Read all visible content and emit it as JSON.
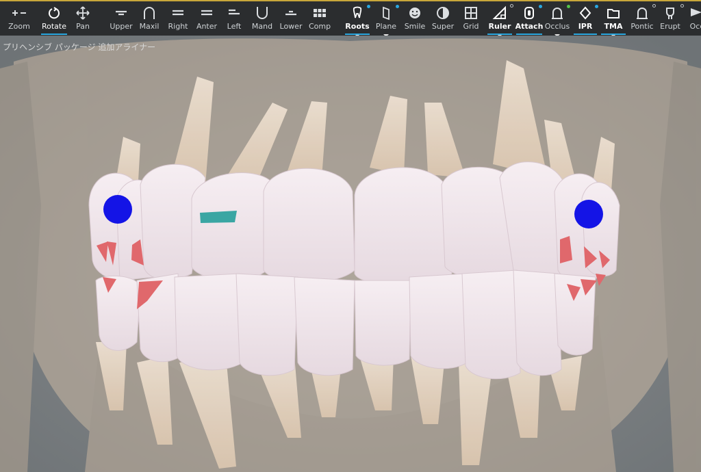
{
  "toolbar": {
    "tools": [
      {
        "label": "Zoom",
        "icon": "zoom-plus-minus-icon"
      },
      {
        "label": "Rotate",
        "icon": "rotate-icon",
        "active": true
      },
      {
        "label": "Pan",
        "icon": "pan-arrows-icon"
      },
      {
        "label": "Upper",
        "icon": "upper-view-icon"
      },
      {
        "label": "Maxil",
        "icon": "maxillary-arch-icon"
      },
      {
        "label": "Right",
        "icon": "right-view-icon"
      },
      {
        "label": "Anter",
        "icon": "anterior-view-icon"
      },
      {
        "label": "Left",
        "icon": "left-view-icon"
      },
      {
        "label": "Mand",
        "icon": "mandibular-arch-icon"
      },
      {
        "label": "Lower",
        "icon": "lower-view-icon"
      },
      {
        "label": "Comp",
        "icon": "compare-grid-icon"
      },
      {
        "label": "Roots",
        "icon": "tooth-root-icon"
      },
      {
        "label": "Plane",
        "icon": "plane-icon"
      },
      {
        "label": "Smile",
        "icon": "smile-face-icon"
      },
      {
        "label": "Super",
        "icon": "superimpose-icon"
      },
      {
        "label": "Grid",
        "icon": "grid-icon"
      },
      {
        "label": "Ruler",
        "icon": "ruler-triangle-icon"
      },
      {
        "label": "Attach",
        "icon": "attachment-icon"
      },
      {
        "label": "Occlus",
        "icon": "occlusion-icon"
      },
      {
        "label": "IPR",
        "icon": "ipr-diamond-icon"
      },
      {
        "label": "TMA",
        "icon": "folder-icon"
      },
      {
        "label": "Pontic",
        "icon": "pontic-icon"
      },
      {
        "label": "Erupt",
        "icon": "erupt-tooth-icon"
      },
      {
        "label": "Occ",
        "icon": "occlusal-triangle-icon"
      }
    ]
  },
  "viewport": {
    "caption": "プリヘンシブ パッケージ 追加アライナー",
    "colors": {
      "background": "#7d8286",
      "aligner": "#efe3ea",
      "root": "#e8d6c3",
      "attachment_marker": "#1414e6",
      "button_cutout": "#3aa6a3",
      "precision_cut": "#e0686c"
    }
  }
}
